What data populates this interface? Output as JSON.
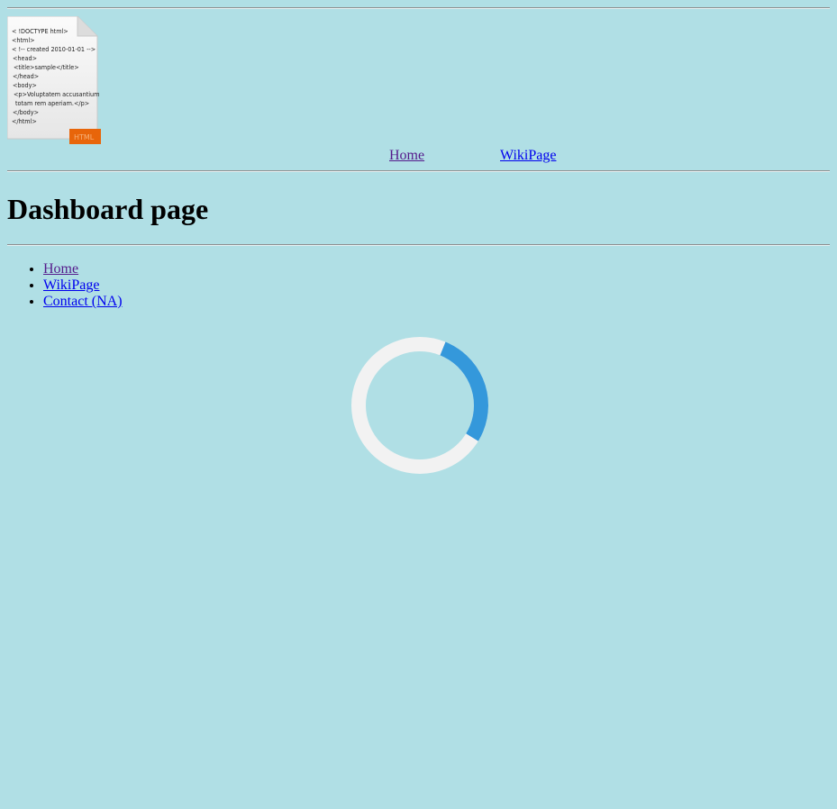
{
  "file_icon": {
    "lines": [
      "< !DOCTYPE html>",
      "<html>",
      "< !-- created 2010-01-01 -->",
      " <head>",
      "  <title>sample</title>",
      " </head>",
      " <body>",
      "  <p>Voluptatem accusantium",
      "   totam rem aperiam.</p>",
      " </body>",
      "</html>"
    ],
    "badge": "HTML"
  },
  "top_nav": {
    "home": "Home",
    "wiki": "WikiPage"
  },
  "page_title": "Dashboard page",
  "side_links": [
    {
      "label": "Home"
    },
    {
      "label": "WikiPage"
    },
    {
      "label": "Contact (NA)"
    }
  ],
  "spinner": {
    "track_color": "#f2f2f2",
    "arc_color": "#3498db"
  }
}
